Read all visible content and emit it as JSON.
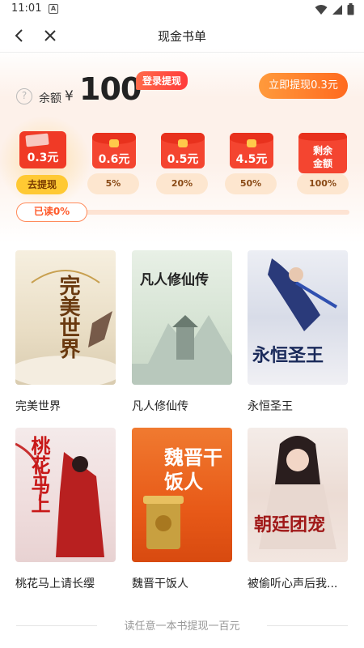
{
  "status": {
    "time": "11:01",
    "a_icon": "A"
  },
  "nav": {
    "title": "现金书单"
  },
  "balance": {
    "label": "余额",
    "currency": "¥",
    "amount": "100",
    "login_badge": "登录提现",
    "withdraw_button": "立即提现0.3元",
    "help": "?"
  },
  "tiers": [
    {
      "value": "0.3元",
      "action": "去提现",
      "active": true
    },
    {
      "value": "0.6元",
      "percent": "5%"
    },
    {
      "value": "0.5元",
      "percent": "20%"
    },
    {
      "value": "4.5元",
      "percent": "50%"
    },
    {
      "value": "剩余金额",
      "value_line1": "剩余",
      "value_line2": "金额",
      "percent": "100%"
    }
  ],
  "progress": {
    "label": "已读0%",
    "value": 0
  },
  "books": [
    {
      "title": "完美世界",
      "cover_text": "完美世界"
    },
    {
      "title": "凡人修仙传",
      "cover_text": "凡人修仙传"
    },
    {
      "title": "永恒圣王",
      "cover_text": "永恒圣王"
    },
    {
      "title": "桃花马上请长缨",
      "cover_text": "桃花马上"
    },
    {
      "title": "魏晋干饭人",
      "cover_text": "魏晋干饭人"
    },
    {
      "title": "被偷听心声后我...",
      "cover_text": "朝廷团宠"
    }
  ],
  "footer": {
    "text": "读任意一本书提现一百元"
  },
  "colors": {
    "accent": "#ff6a1f",
    "envelope": "#f44530",
    "badge": "#ff3b3b"
  }
}
